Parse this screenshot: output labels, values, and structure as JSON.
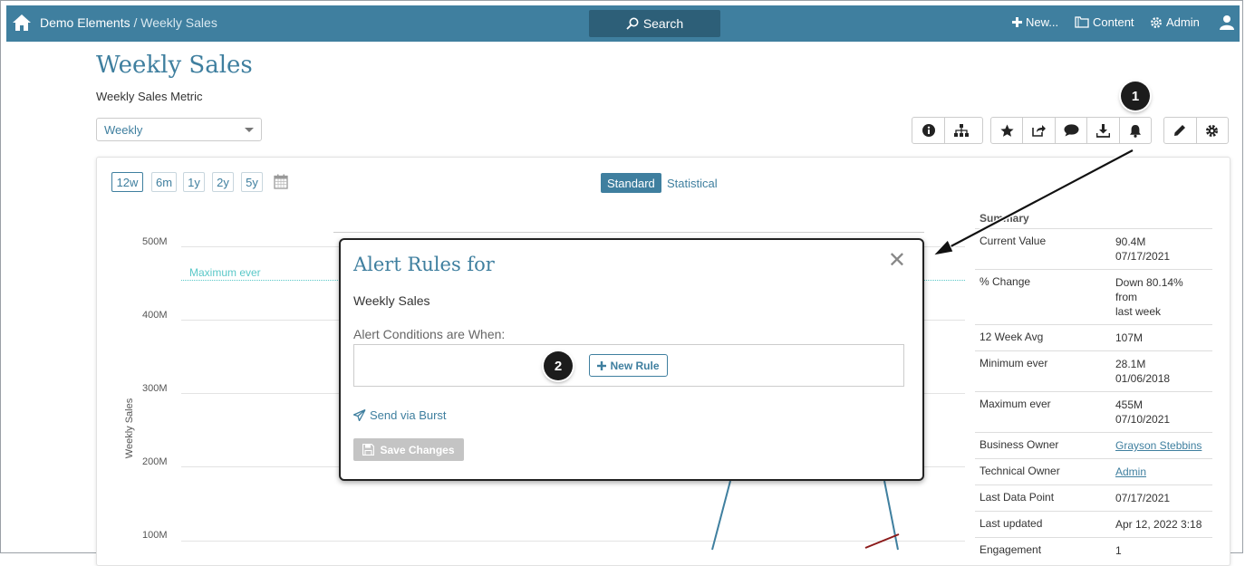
{
  "topbar": {
    "crumb_home": "Demo Elements",
    "crumb_sep": " / ",
    "crumb_current": "Weekly Sales",
    "search_label": "Search",
    "new_label": "New...",
    "content_label": "Content",
    "admin_label": "Admin"
  },
  "page": {
    "title": "Weekly Sales",
    "subtitle": "Weekly Sales Metric",
    "select_value": "Weekly"
  },
  "callouts": {
    "one": "1",
    "two": "2"
  },
  "chart": {
    "ranges": [
      "12w",
      "6m",
      "1y",
      "2y",
      "5y"
    ],
    "active_range": "12w",
    "view_standard": "Standard",
    "view_statistical": "Statistical",
    "ylabel": "Weekly Sales",
    "yticks": [
      "500M",
      "400M",
      "300M",
      "200M",
      "100M"
    ],
    "max_label": "Maximum ever"
  },
  "summary": {
    "header": "Summary",
    "rows": [
      {
        "k": "Current Value",
        "v1": "90.4M",
        "v2": "07/17/2021"
      },
      {
        "k": "% Change",
        "v1": "Down 80.14% from",
        "v2": "last week"
      },
      {
        "k": "12 Week Avg",
        "v1": "107M",
        "v2": ""
      },
      {
        "k": "Minimum ever",
        "v1": "28.1M",
        "v2": "01/06/2018"
      },
      {
        "k": "Maximum ever",
        "v1": "455M",
        "v2": "07/10/2021"
      },
      {
        "k": "Business Owner",
        "v1": "Grayson Stebbins",
        "v2": ""
      },
      {
        "k": "Technical Owner",
        "v1": "Admin",
        "v2": ""
      },
      {
        "k": "Last Data Point",
        "v1": "07/17/2021",
        "v2": ""
      },
      {
        "k": "Last updated",
        "v1": "Apr 12, 2022 3:18",
        "v2": ""
      },
      {
        "k": "Engagement",
        "v1": "1",
        "v2": ""
      }
    ]
  },
  "modal": {
    "title": "Alert Rules for",
    "subtitle": "Weekly Sales",
    "conditions_label": "Alert Conditions are When:",
    "new_rule": "New Rule",
    "send_burst": "Send via Burst",
    "save": "Save Changes"
  },
  "colors": {
    "brand": "#3f7f9f",
    "accent_line": "#5ac8c8",
    "callout": "#1c1c1c"
  }
}
